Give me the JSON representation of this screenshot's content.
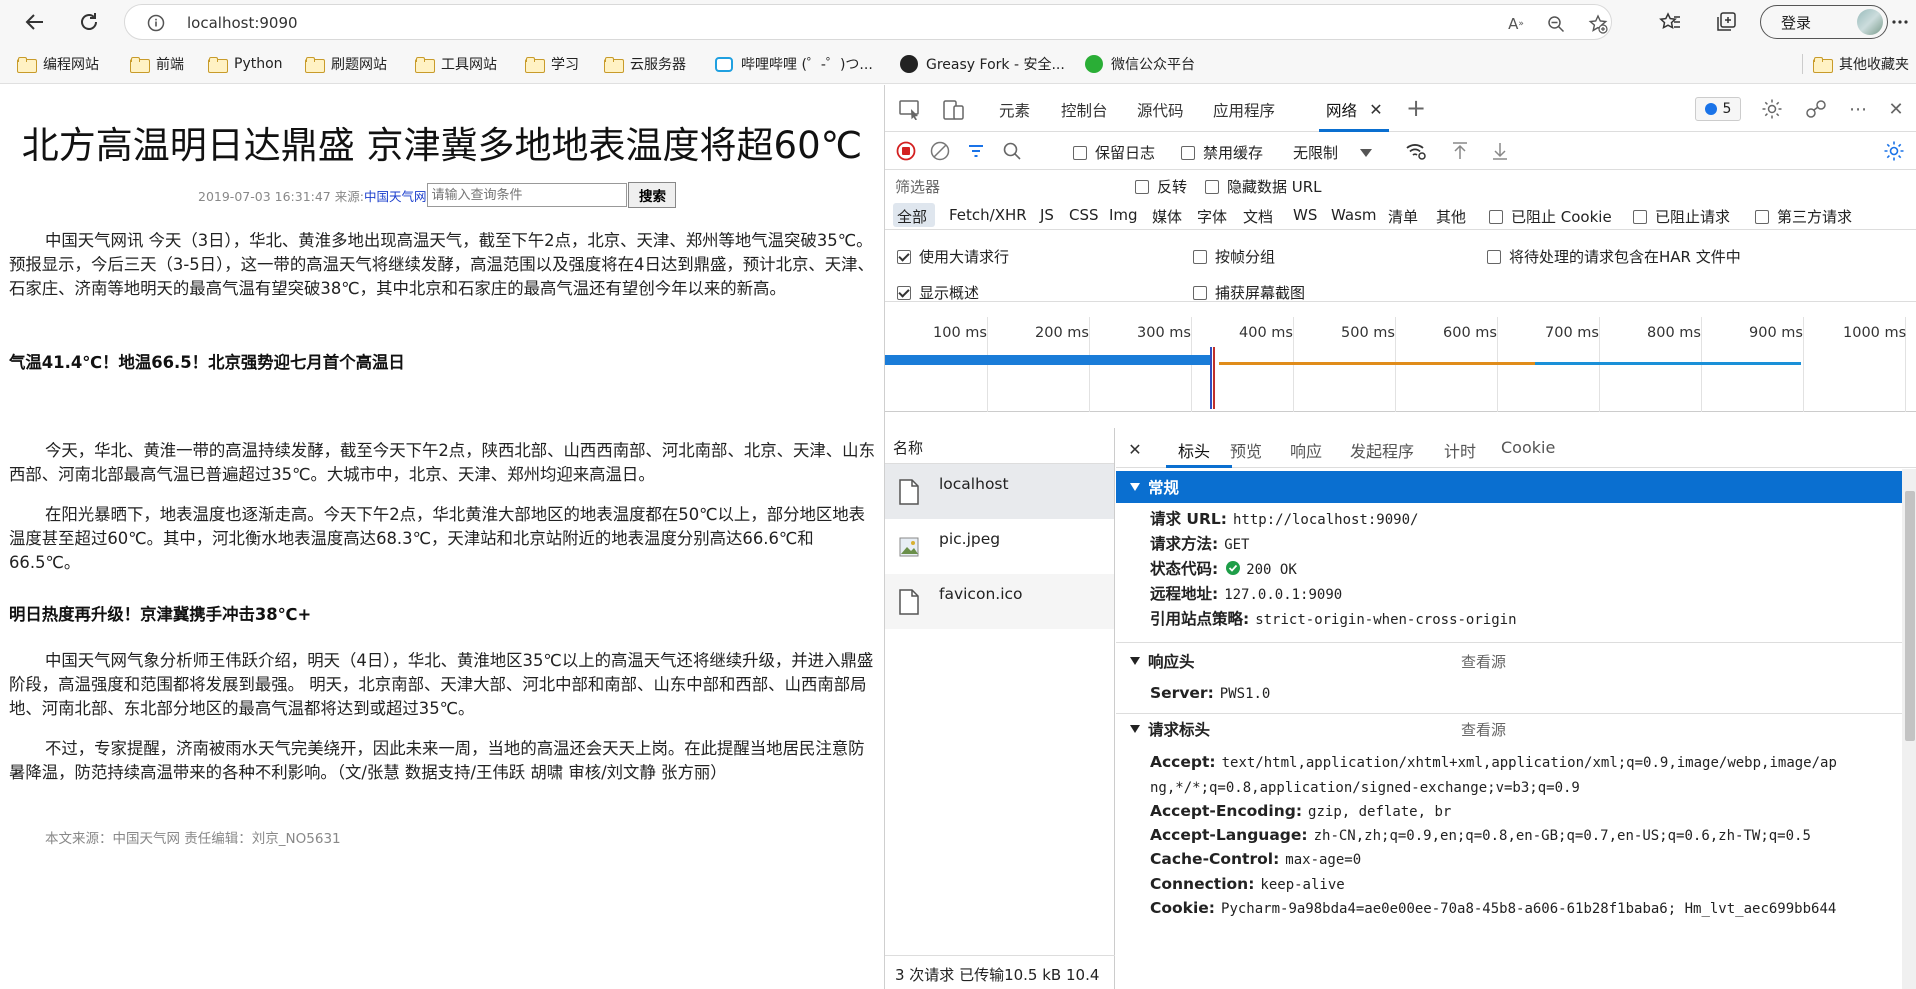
{
  "browser": {
    "url": "localhost:9090",
    "login_label": "登录",
    "bookmarks": [
      {
        "label": "编程网站",
        "icon": "folder-icon"
      },
      {
        "label": "前端",
        "icon": "folder-icon"
      },
      {
        "label": "Python",
        "icon": "folder-icon"
      },
      {
        "label": "刷题网站",
        "icon": "folder-icon"
      },
      {
        "label": "工具网站",
        "icon": "folder-icon"
      },
      {
        "label": "学习",
        "icon": "folder-icon"
      },
      {
        "label": "云服务器",
        "icon": "folder-icon"
      },
      {
        "label": "哔哩哔哩 (゜-゜)つ...",
        "icon": "bilibili-icon"
      },
      {
        "label": "Greasy Fork - 安全...",
        "icon": "greasyfork-icon"
      },
      {
        "label": "微信公众平台",
        "icon": "wechat-icon"
      }
    ],
    "other_bookmarks": "其他收藏夹"
  },
  "article": {
    "title": "北方高温明日达鼎盛 京津冀多地地表温度将超60℃",
    "meta_date": "2019-07-03 16:31:47 来源: ",
    "meta_source": "中国天气网",
    "search_placeholder": "请输入查询条件",
    "search_button": "搜索",
    "p1": "中国天气网讯 今天（3日），华北、黄淮多地出现高温天气，截至下午2点，北京、天津、郑州等地气温突破35℃。预报显示，今后三天（3-5日），这一带的高温天气将继续发酵，高温范围以及强度将在4日达到鼎盛，预计北京、天津、石家庄、济南等地明天的最高气温有望突破38℃，其中北京和石家庄的最高气温还有望创今年以来的新高。",
    "h1": "气温41.4℃！地温66.5！北京强势迎七月首个高温日",
    "p2": "今天，华北、黄淮一带的高温持续发酵，截至今天下午2点，陕西北部、山西西南部、河北南部、北京、天津、山东西部、河南北部最高气温已普遍超过35℃。大城市中，北京、天津、郑州均迎来高温日。",
    "p3": "在阳光暴晒下，地表温度也逐渐走高。今天下午2点，华北黄淮大部地区的地表温度都在50℃以上，部分地区地表温度甚至超过60℃。其中，河北衡水地表温度高达68.3℃，天津站和北京站附近的地表温度分别高达66.6℃和66.5℃。",
    "h2": "明日热度再升级！京津冀携手冲击38℃+",
    "p4": "中国天气网气象分析师王伟跃介绍，明天（4日），华北、黄淮地区35℃以上的高温天气还将继续升级，并进入鼎盛阶段，高温强度和范围都将发展到最强。 明天，北京南部、天津大部、河北中部和南部、山东中部和西部、山西南部局地、河南北部、东北部分地区的最高气温都将达到或超过35℃。",
    "p5": "不过，专家提醒，济南被雨水天气完美绕开，因此未来一周，当地的高温还会天天上岗。在此提醒当地居民注意防暑降温，防范持续高温带来的各种不利影响。（文/张慧 数据支持/王伟跃 胡啸 审核/刘文静 张方丽）",
    "footnote": "本文来源：中国天气网 责任编辑：刘京_NO5631"
  },
  "devtools": {
    "tabs": [
      "元素",
      "控制台",
      "源代码",
      "应用程序",
      "网络"
    ],
    "active_tab": "网络",
    "issues_count": "5",
    "toolbar": {
      "preserve_log": "保留日志",
      "disable_cache": "禁用缓存",
      "throttling": "无限制"
    },
    "filter": {
      "placeholder": "筛选器",
      "invert": "反转",
      "hide_data_urls": "隐藏数据 URL"
    },
    "types": [
      "全部",
      "Fetch/XHR",
      "JS",
      "CSS",
      "Img",
      "媒体",
      "字体",
      "文档",
      "WS",
      "Wasm",
      "清单",
      "其他"
    ],
    "blocked_cookies": "已阻止 Cookie",
    "blocked_requests": "已阻止请求",
    "third_party": "第三方请求",
    "options": {
      "large_rows": "使用大请求行",
      "group_by_frame": "按帧分组",
      "har_pending": "将待处理的请求包含在HAR 文件中",
      "overview": "显示概述",
      "screenshots": "捕获屏幕截图"
    },
    "timeline_ticks": [
      "100 ms",
      "200 ms",
      "300 ms",
      "400 ms",
      "500 ms",
      "600 ms",
      "700 ms",
      "800 ms",
      "900 ms",
      "1000 ms"
    ],
    "list_header": "名称",
    "requests": [
      "localhost",
      "pic.jpeg",
      "favicon.ico"
    ],
    "summary": "3 次请求  已传输10.5 kB  10.4",
    "detail_tabs": [
      "标头",
      "预览",
      "响应",
      "发起程序",
      "计时",
      "Cookie"
    ],
    "general_title": "常规",
    "general": [
      {
        "k": "请求 URL:",
        "v": "http://localhost:9090/"
      },
      {
        "k": "请求方法:",
        "v": "GET"
      },
      {
        "k": "状态代码:",
        "v": "200 OK"
      },
      {
        "k": "远程地址:",
        "v": "127.0.0.1:9090"
      },
      {
        "k": "引用站点策略:",
        "v": "strict-origin-when-cross-origin"
      }
    ],
    "response_headers_title": "响应头",
    "view_source": "查看源",
    "response_headers": [
      {
        "k": "Server:",
        "v": "PWS1.0"
      }
    ],
    "request_headers_title": "请求标头",
    "request_headers": [
      {
        "k": "Accept:",
        "v": "text/html,application/xhtml+xml,application/xml;q=0.9,image/webp,image/ap",
        "v2": "ng,*/*;q=0.8,application/signed-exchange;v=b3;q=0.9"
      },
      {
        "k": "Accept-Encoding:",
        "v": "gzip, deflate, br"
      },
      {
        "k": "Accept-Language:",
        "v": "zh-CN,zh;q=0.9,en;q=0.8,en-GB;q=0.7,en-US;q=0.6,zh-TW;q=0.5"
      },
      {
        "k": "Cache-Control:",
        "v": "max-age=0"
      },
      {
        "k": "Connection:",
        "v": "keep-alive"
      },
      {
        "k": "Cookie:",
        "v": "Pycharm-9a98bda4=ae0e00ee-70a8-45b8-a606-61b28f1baba6; Hm_lvt_aec699bb644"
      }
    ]
  }
}
